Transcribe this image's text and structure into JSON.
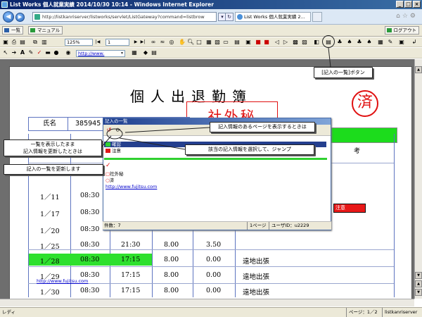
{
  "window": {
    "title": "List Works 個人就業実績 2014/10/30 10:14 - Windows Internet Explorer",
    "buttons": [
      "_",
      "□",
      "×"
    ]
  },
  "browser": {
    "url": "http://listkanriserver/listworks/servlet/ListGateway?command=listbrow",
    "tab_title": "List Works 個人就業実績 2..."
  },
  "menubar": {
    "list_label": "一覧",
    "manual_label": "マニュアル",
    "logout_label": "ログアウト"
  },
  "toolbar": {
    "zoom_value": "125%",
    "page_value": "1",
    "link_value": "http://www."
  },
  "document": {
    "title": "個人出退勤簿",
    "stamp_done": "済",
    "stamp_box": "社外秘",
    "name_label": "氏名",
    "name_value": "385945",
    "column_remarks": "考",
    "rows": [
      {
        "date": "1／11",
        "in": "08:30",
        "out": "",
        "hours": "",
        "ot": "",
        "note": ""
      },
      {
        "date": "1／17",
        "in": "08:30",
        "out": "",
        "hours": "",
        "ot": "",
        "note": ""
      },
      {
        "date": "1／20",
        "in": "08:30",
        "out": "",
        "hours": "",
        "ot": "",
        "note": ""
      },
      {
        "date": "1／25",
        "in": "08:30",
        "out": "21:30",
        "hours": "8.00",
        "ot": "3.50",
        "note": ""
      },
      {
        "date": "1／28",
        "in": "08:30",
        "out": "17:15",
        "hours": "8.00",
        "ot": "0.00",
        "note": "遠地出張"
      },
      {
        "date": "1／29",
        "in": "08:30",
        "out": "17:15",
        "hours": "8.00",
        "ot": "0.00",
        "note": "遠地出張"
      },
      {
        "date": "1／30",
        "in": "08:30",
        "out": "17:15",
        "hours": "8.00",
        "ot": "0.00",
        "note": "遠地出張"
      }
    ],
    "red_mark": "注意",
    "doc_link": "http://www.fujitsu.com",
    "partial_date": "30"
  },
  "popup": {
    "title": "記入の一覧",
    "item_confirm": "確認",
    "item_note": "注意",
    "stamp_item_1": "社外秘",
    "stamp_item_2": "済",
    "link_item": "http://www.fujitsu.com",
    "count_label": "件数：7",
    "page_label": "1ページ",
    "user_label": "ユーザID：u2229"
  },
  "callouts": {
    "list_button": "[記入の一覧]ボタン",
    "show_page": "記入情報のあるページを表示するときは",
    "select_jump": "該当の記入情報を選択して、ジャンプ",
    "update_keep": "一覧を表示したまま\n記入情報を更新したときは",
    "update_list": "記入の一覧を更新します"
  },
  "statusbar": {
    "left": "レディ",
    "page": "ページ：1／2",
    "server": "listkanriserver"
  },
  "colors": {
    "accent_blue": "#0a246a",
    "stamp_red": "#e01010",
    "highlight_green": "#2ee02e"
  }
}
